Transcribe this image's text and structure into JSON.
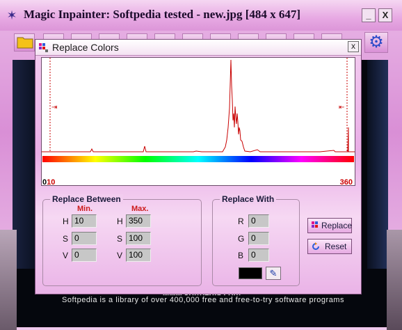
{
  "window": {
    "title": "Magic Inpainter: Softpedia tested - new.jpg  [484 x 647]",
    "minimize_label": "_",
    "close_label": "X"
  },
  "toolbar": {
    "icons": [
      "folder-icon",
      "settings-icon"
    ]
  },
  "canvas": {
    "caption": "Softpedia is a library of over 400,000 free and free-to-try software programs",
    "site_text": "www.softpedia.com"
  },
  "dialog": {
    "title": "Replace Colors",
    "close_label": "x",
    "histogram": {
      "min_zero": "0",
      "min_value": "10",
      "max_value": "360"
    },
    "replace_between": {
      "title": "Replace Between",
      "min_label": "Min.",
      "max_label": "Max.",
      "h_label": "H",
      "s_label": "S",
      "v_label": "V",
      "min": {
        "h": "10",
        "s": "0",
        "v": "0"
      },
      "max": {
        "h": "350",
        "s": "100",
        "v": "100"
      }
    },
    "replace_with": {
      "title": "Replace With",
      "r_label": "R",
      "g_label": "G",
      "b_label": "B",
      "r": "0",
      "g": "0",
      "b": "0",
      "swatch_color": "#000000"
    },
    "buttons": {
      "replace": "Replace",
      "reset": "Reset"
    }
  }
}
